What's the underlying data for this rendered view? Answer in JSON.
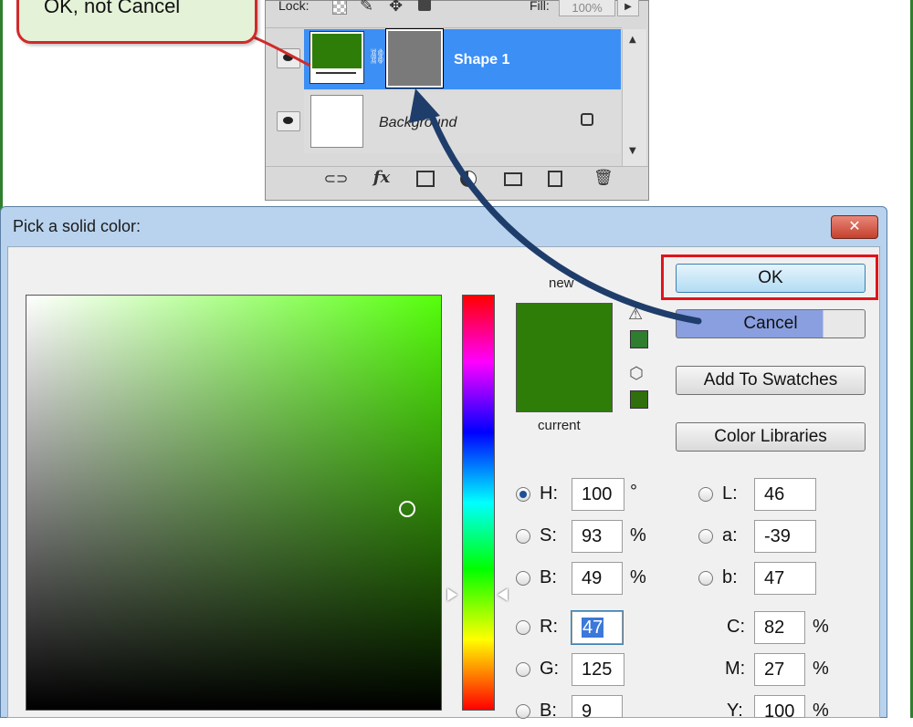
{
  "callout": {
    "text": "OK, not Cancel"
  },
  "layers_panel": {
    "lock_label": "Lock:",
    "fill_label": "Fill:",
    "fill_value": "100%",
    "layers": [
      {
        "name": "Shape 1",
        "selected": true,
        "thumb_color": "#2f7d09",
        "mask_color": "#7a7a7a"
      },
      {
        "name": "Background",
        "selected": false,
        "thumb_color": "#ffffff"
      }
    ],
    "footer_icons": [
      "link-icon",
      "fx-icon",
      "mask-icon",
      "adjustment-icon",
      "folder-icon",
      "new-layer-icon",
      "trash-icon"
    ],
    "fx_label": "fx"
  },
  "dialog": {
    "title": "Pick a solid color:",
    "close_label": "✕",
    "new_label": "new",
    "current_label": "current",
    "new_color": "#2f7d09",
    "current_color": "#2f7d09",
    "buttons": {
      "ok": "OK",
      "cancel": "Cancel",
      "add_to_swatches": "Add To Swatches",
      "color_libraries": "Color Libraries"
    },
    "fields_left": [
      {
        "label": "H:",
        "value": "100",
        "unit": "°",
        "selected": true
      },
      {
        "label": "S:",
        "value": "93",
        "unit": "%",
        "selected": false
      },
      {
        "label": "B:",
        "value": "49",
        "unit": "%",
        "selected": false
      },
      {
        "label": "R:",
        "value": "47",
        "unit": "",
        "selected": false
      },
      {
        "label": "G:",
        "value": "125",
        "unit": "",
        "selected": false
      },
      {
        "label": "B:",
        "value": "9",
        "unit": "",
        "selected": false
      }
    ],
    "fields_right": [
      {
        "label": "L:",
        "value": "46",
        "unit": ""
      },
      {
        "label": "a:",
        "value": "-39",
        "unit": ""
      },
      {
        "label": "b:",
        "value": "47",
        "unit": ""
      },
      {
        "label": "C:",
        "value": "82",
        "unit": "%"
      },
      {
        "label": "M:",
        "value": "27",
        "unit": "%"
      },
      {
        "label": "Y:",
        "value": "100",
        "unit": "%"
      }
    ]
  },
  "colors": {
    "frame_green": "#2f7f2f",
    "callout_border": "#d12a2a",
    "selection_blue": "#3c8ff5",
    "highlight_red": "#e0141b",
    "arrow_navy": "#1f3d6b"
  }
}
